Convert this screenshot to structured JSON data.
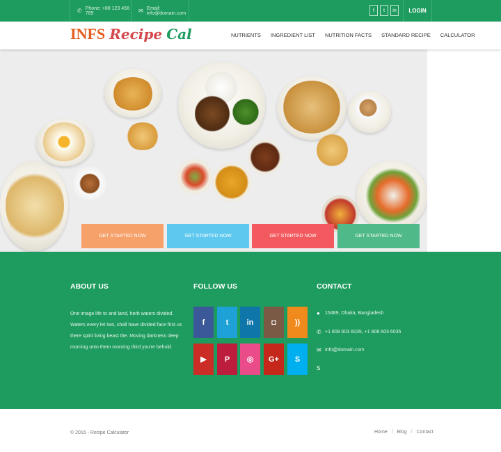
{
  "topbar": {
    "phone": "Phone: +88 123 456 789",
    "email": "Email: info@domain.com",
    "social": [
      {
        "icon": "facebook-icon",
        "glyph": "f"
      },
      {
        "icon": "twitter-icon",
        "glyph": "t"
      },
      {
        "icon": "linkedin-icon",
        "glyph": "in"
      }
    ],
    "login": "LOGIN"
  },
  "header": {
    "logo_part1": "INFS",
    "logo_part2": "Recipe",
    "logo_part3": "Cal",
    "menu": [
      "NUTRIENTS",
      "INGREDIENT LIST",
      "NUTRITION FACTS",
      "STANDARD RECIPE",
      "CALCULATOR"
    ]
  },
  "hero": {
    "buttons": [
      {
        "label": "GET STARTED NOW",
        "color": "#f6a06a"
      },
      {
        "label": "GET STARTED NOW",
        "color": "#5ec8ee"
      },
      {
        "label": "GET STARTED NOW",
        "color": "#f35a5f"
      },
      {
        "label": "GET STARTED NOW",
        "color": "#4fb989"
      }
    ]
  },
  "footer": {
    "about_title": "ABOUT US",
    "about_text": "One image life to and land, herb waters divided. Waters every let two, shall have divided face first us there spirit living beast the. Moving darkness deep morning unto them morning third you're behold.",
    "follow_title": "FOLLOW US",
    "social": [
      {
        "icon": "facebook-icon",
        "glyph": "f",
        "color": "#3b5998"
      },
      {
        "icon": "twitter-icon",
        "glyph": "t",
        "color": "#1da1d6"
      },
      {
        "icon": "linkedin-icon",
        "glyph": "in",
        "color": "#0e76a8"
      },
      {
        "icon": "instagram-icon",
        "glyph": "◘",
        "color": "#7b5a45"
      },
      {
        "icon": "rss-icon",
        "glyph": "))",
        "color": "#f08a1c"
      },
      {
        "icon": "youtube-icon",
        "glyph": "▶",
        "color": "#cc2c26"
      },
      {
        "icon": "pinterest-icon",
        "glyph": "P",
        "color": "#bd1c3c"
      },
      {
        "icon": "dribbble-icon",
        "glyph": "◎",
        "color": "#ea4c89"
      },
      {
        "icon": "google-plus-icon",
        "glyph": "G+",
        "color": "#c5281b"
      },
      {
        "icon": "skype-icon",
        "glyph": "S",
        "color": "#00aff0"
      }
    ],
    "contact_title": "CONTACT",
    "contact": [
      {
        "icon": "map-marker-icon",
        "glyph": "●",
        "text": "15489, Dhaka, Bangladesh"
      },
      {
        "icon": "phone-icon",
        "glyph": "✆",
        "text": "+1 808 603 6035, +1 808 603 6035"
      },
      {
        "icon": "envelope-icon",
        "glyph": "✉",
        "text": "info@domain.com"
      },
      {
        "icon": "skype-icon",
        "glyph": "S",
        "text": ""
      }
    ]
  },
  "bottom": {
    "copyright": "© 2016 - Recipe Calculator",
    "links": [
      "Home",
      "Blog",
      "Contact"
    ]
  },
  "colors": {
    "brand_green": "#1e9b5e",
    "logo_orange": "#e35d1e",
    "logo_red": "#d4484b"
  }
}
